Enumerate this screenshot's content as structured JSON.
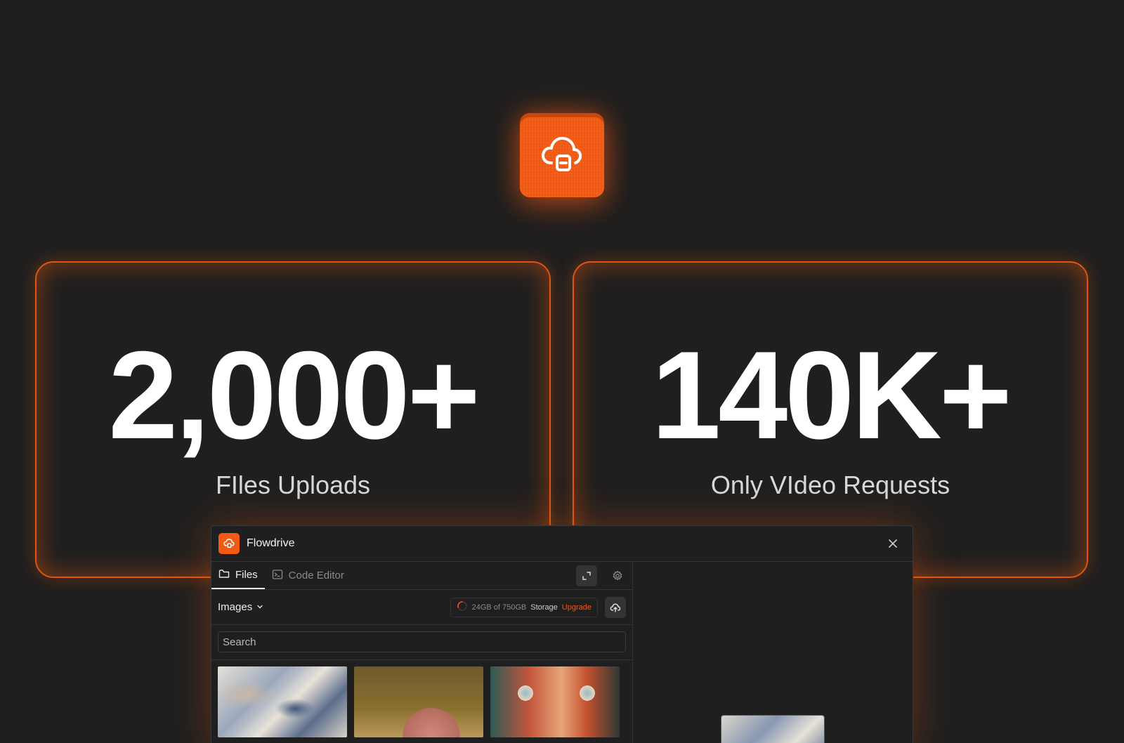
{
  "hero": {
    "icon": "cloud-lock-icon",
    "accent": "#f05a14"
  },
  "stats": [
    {
      "value": "2,000+",
      "label": "FIles Uploads"
    },
    {
      "value": "140K+",
      "label": "Only VIdeo Requests"
    }
  ],
  "window": {
    "title": "Flowdrive",
    "tabs": [
      {
        "label": "Files",
        "icon": "folder-icon",
        "active": true
      },
      {
        "label": "Code Editor",
        "icon": "terminal-icon",
        "active": false
      }
    ],
    "folder": "Images",
    "storage": {
      "used_text": "24GB of 750GB",
      "storage_word": "Storage",
      "upgrade_label": "Upgrade",
      "used_fraction": 0.032
    },
    "search_placeholder": "Search",
    "thumbnails": [
      "abstract-swirl",
      "pink-vase",
      "painted-face"
    ]
  },
  "colors": {
    "background": "#1f1f1f",
    "card_border": "#e2550f",
    "link": "#f05a14"
  }
}
